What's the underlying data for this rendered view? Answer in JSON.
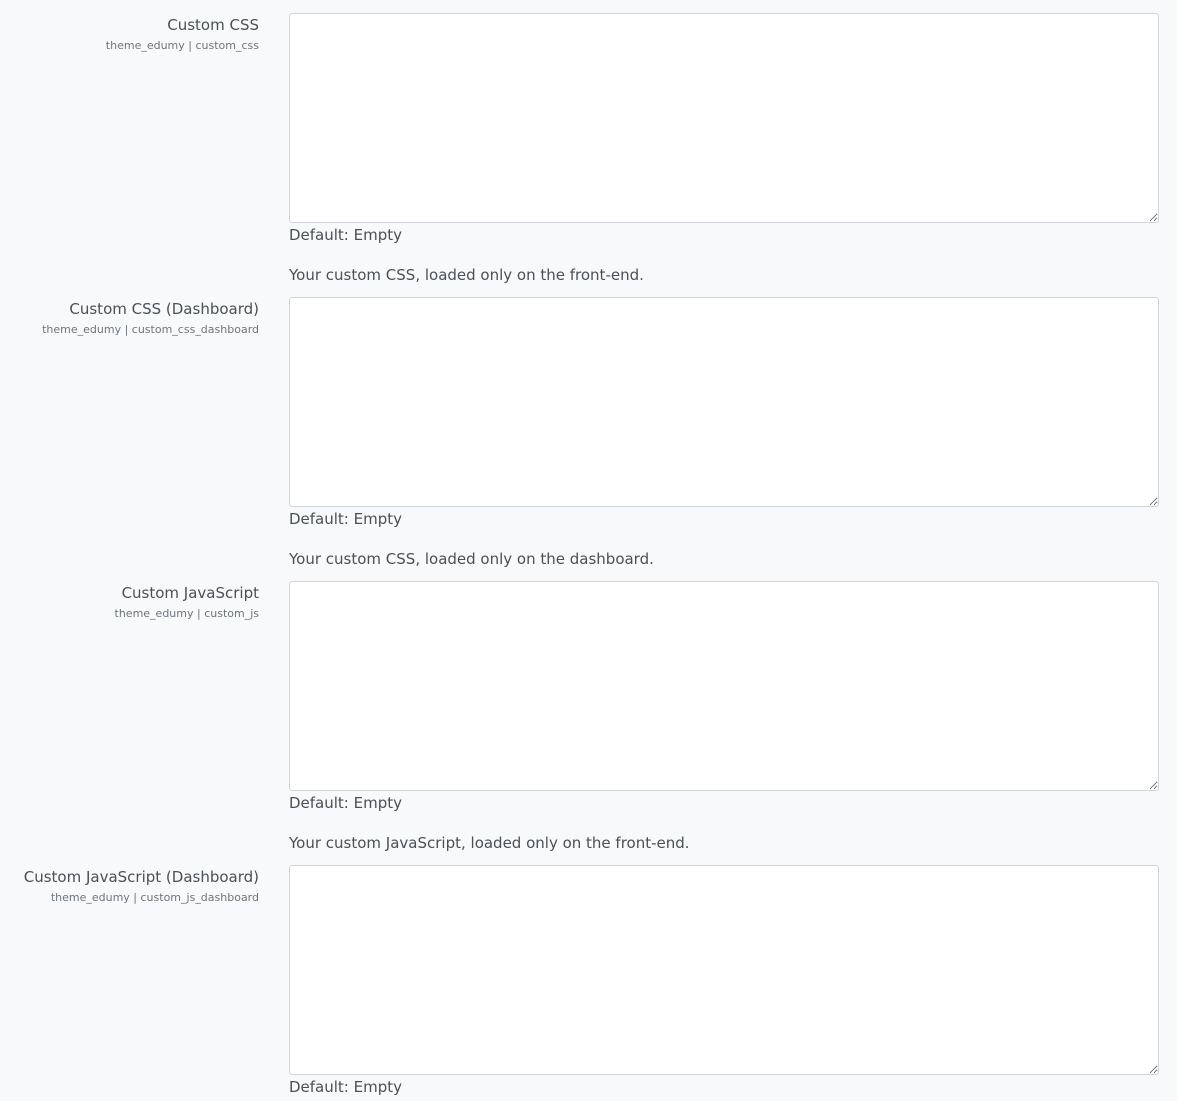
{
  "top_fragment": "... ... ...",
  "settings": [
    {
      "title": "Custom CSS",
      "key": "theme_edumy | custom_css",
      "value": "",
      "default": "Default: Empty"
    },
    {
      "description": "Your custom CSS, loaded only on the front-end.",
      "title": "Custom CSS (Dashboard)",
      "key": "theme_edumy | custom_css_dashboard",
      "value": "",
      "default": "Default: Empty"
    },
    {
      "description": "Your custom CSS, loaded only on the dashboard.",
      "title": "Custom JavaScript",
      "key": "theme_edumy | custom_js",
      "value": "",
      "default": "Default: Empty"
    },
    {
      "description": "Your custom JavaScript, loaded only on the front-end.",
      "title": "Custom JavaScript (Dashboard)",
      "key": "theme_edumy | custom_js_dashboard",
      "value": "",
      "default": "Default: Empty"
    }
  ]
}
